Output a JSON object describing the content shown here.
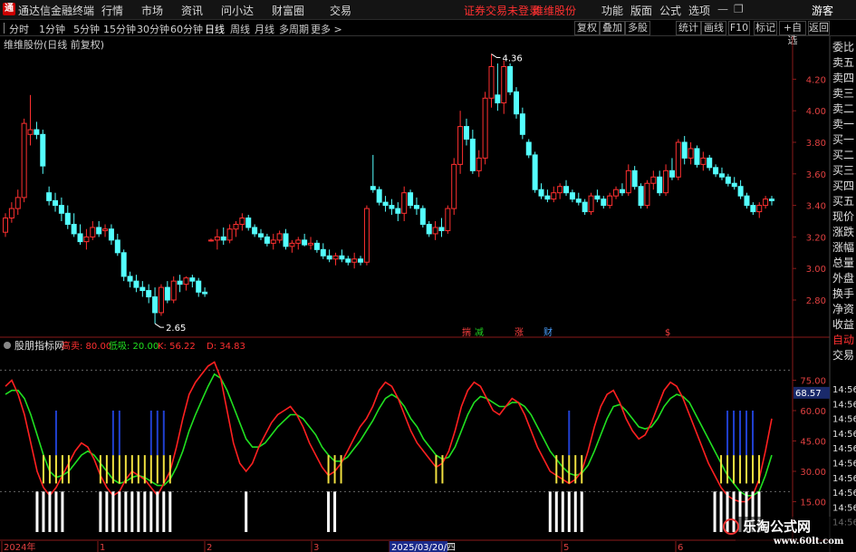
{
  "app": {
    "title": "通达信金融终端",
    "login_status": "证券交易未登录",
    "stock_name": "维维股份"
  },
  "menu": {
    "left": [
      "行情",
      "市场",
      "资讯",
      "问小达",
      "财富圈",
      "交易"
    ],
    "right": [
      "功能",
      "版面",
      "公式",
      "选项"
    ],
    "guest": "游客"
  },
  "toolbar": {
    "periods": [
      "分时",
      "1分钟",
      "5分钟",
      "15分钟",
      "30分钟",
      "60分钟",
      "日线",
      "周线",
      "月线",
      "多周期",
      "更多 >"
    ],
    "active_period": "日线",
    "buttons": [
      "复权",
      "叠加",
      "多股",
      "统计",
      "画线",
      "F10",
      "标记",
      "+自选",
      "返回"
    ]
  },
  "main_panel": {
    "title": "维维股份(日线 前复权)",
    "y_ticks": [
      "4.20",
      "4.00",
      "3.80",
      "3.60",
      "3.40",
      "3.20",
      "3.00",
      "2.80"
    ],
    "high_label": "4.36",
    "low_label": "2.65",
    "events": [
      {
        "text": "揣",
        "color": "#ff4040"
      },
      {
        "text": "减",
        "color": "#20d020"
      },
      {
        "text": "涨",
        "color": "#ff4040"
      },
      {
        "text": "财",
        "color": "#4aa0ff"
      },
      {
        "text": "$",
        "color": "#ff4040"
      }
    ]
  },
  "indicator": {
    "name": "股朋指标网",
    "params": [
      {
        "label": "高卖:",
        "value": "80.00",
        "color": "#ff3030"
      },
      {
        "label": "低吸:",
        "value": "20.00",
        "color": "#20e020"
      },
      {
        "label": "K:",
        "value": "56.22",
        "color": "#ff3030"
      },
      {
        "label": "D:",
        "value": "34.83",
        "color": "#ff3030"
      }
    ],
    "y_ticks": [
      "75.00",
      "60.00",
      "45.00",
      "30.00",
      "15.00"
    ],
    "current_value": "68.57"
  },
  "x_axis": {
    "labels": [
      "2024年",
      "1",
      "2",
      "3",
      "2025/03/20/四",
      "5",
      "6"
    ]
  },
  "right_panel": {
    "items": [
      "委比",
      "卖五",
      "卖四",
      "卖三",
      "卖二",
      "卖一",
      "买一",
      "买二",
      "买三",
      "买四",
      "买五",
      "现价",
      "涨跌",
      "涨幅",
      "总量",
      "外盘",
      "换手",
      "净资",
      "收益",
      "自动",
      "交易"
    ],
    "times": [
      "14:56",
      "14:56",
      "14:56",
      "14:56",
      "14:56",
      "14:56",
      "14:56",
      "14:56",
      "14:56",
      "14:56"
    ]
  },
  "colors": {
    "up": "#ff3030",
    "down": "#54ffff",
    "k_line": "#ff2020",
    "d_line": "#20e020",
    "accent": "#ff3030"
  },
  "watermark": {
    "site_name": "乐淘公式网",
    "url": "www.60lt.com"
  },
  "chart_data": {
    "type": "candlestick",
    "title": "维维股份(日线 前复权)",
    "ylim": [
      2.6,
      4.45
    ],
    "ohlc": [
      [
        3.23,
        3.35,
        3.2,
        3.32
      ],
      [
        3.32,
        3.42,
        3.29,
        3.38
      ],
      [
        3.38,
        3.5,
        3.34,
        3.45
      ],
      [
        3.45,
        3.95,
        3.42,
        3.92
      ],
      [
        3.85,
        4.1,
        3.78,
        3.88
      ],
      [
        3.88,
        3.93,
        3.82,
        3.85
      ],
      [
        3.85,
        3.88,
        3.6,
        3.65
      ],
      [
        3.48,
        3.52,
        3.4,
        3.43
      ],
      [
        3.43,
        3.48,
        3.36,
        3.4
      ],
      [
        3.4,
        3.45,
        3.3,
        3.35
      ],
      [
        3.35,
        3.4,
        3.25,
        3.28
      ],
      [
        3.28,
        3.35,
        3.2,
        3.22
      ],
      [
        3.22,
        3.28,
        3.15,
        3.17
      ],
      [
        3.17,
        3.25,
        3.12,
        3.2
      ],
      [
        3.2,
        3.3,
        3.18,
        3.26
      ],
      [
        3.26,
        3.3,
        3.2,
        3.22
      ],
      [
        3.24,
        3.28,
        3.2,
        3.25
      ],
      [
        3.25,
        3.28,
        3.15,
        3.18
      ],
      [
        3.18,
        3.22,
        3.08,
        3.1
      ],
      [
        3.1,
        3.12,
        2.92,
        2.95
      ],
      [
        2.95,
        2.98,
        2.88,
        2.92
      ],
      [
        2.92,
        2.96,
        2.85,
        2.88
      ],
      [
        2.88,
        2.92,
        2.82,
        2.86
      ],
      [
        2.86,
        2.9,
        2.78,
        2.82
      ],
      [
        2.82,
        2.88,
        2.65,
        2.72
      ],
      [
        2.72,
        2.9,
        2.7,
        2.88
      ],
      [
        2.88,
        2.92,
        2.78,
        2.8
      ],
      [
        2.8,
        2.95,
        2.78,
        2.92
      ],
      [
        2.92,
        2.96,
        2.85,
        2.9
      ],
      [
        2.9,
        2.95,
        2.86,
        2.94
      ],
      [
        2.94,
        2.96,
        2.88,
        2.92
      ],
      [
        2.92,
        2.94,
        2.82,
        2.85
      ],
      [
        2.85,
        2.88,
        2.82,
        2.84
      ],
      [
        3.18,
        3.19,
        3.17,
        3.18
      ],
      [
        3.18,
        3.25,
        3.12,
        3.2
      ],
      [
        3.2,
        3.26,
        3.15,
        3.18
      ],
      [
        3.18,
        3.28,
        3.16,
        3.25
      ],
      [
        3.25,
        3.3,
        3.2,
        3.28
      ],
      [
        3.28,
        3.35,
        3.24,
        3.32
      ],
      [
        3.32,
        3.34,
        3.24,
        3.26
      ],
      [
        3.26,
        3.28,
        3.2,
        3.22
      ],
      [
        3.22,
        3.25,
        3.18,
        3.2
      ],
      [
        3.2,
        3.22,
        3.14,
        3.16
      ],
      [
        3.16,
        3.22,
        3.12,
        3.18
      ],
      [
        3.18,
        3.24,
        3.16,
        3.22
      ],
      [
        3.22,
        3.25,
        3.12,
        3.14
      ],
      [
        3.14,
        3.18,
        3.1,
        3.16
      ],
      [
        3.16,
        3.2,
        3.12,
        3.18
      ],
      [
        3.18,
        3.22,
        3.14,
        3.15
      ],
      [
        3.15,
        3.2,
        3.12,
        3.16
      ],
      [
        3.16,
        3.18,
        3.1,
        3.12
      ],
      [
        3.12,
        3.16,
        3.06,
        3.08
      ],
      [
        3.08,
        3.12,
        3.04,
        3.06
      ],
      [
        3.06,
        3.1,
        3.02,
        3.08
      ],
      [
        3.08,
        3.12,
        3.04,
        3.06
      ],
      [
        3.06,
        3.08,
        3.02,
        3.04
      ],
      [
        3.04,
        3.1,
        3.0,
        3.06
      ],
      [
        3.06,
        3.08,
        3.02,
        3.04
      ],
      [
        3.04,
        3.4,
        3.02,
        3.38
      ],
      [
        3.52,
        3.72,
        3.48,
        3.5
      ],
      [
        3.5,
        3.52,
        3.4,
        3.42
      ],
      [
        3.42,
        3.46,
        3.36,
        3.4
      ],
      [
        3.4,
        3.44,
        3.34,
        3.38
      ],
      [
        3.38,
        3.42,
        3.3,
        3.35
      ],
      [
        3.35,
        3.52,
        3.3,
        3.48
      ],
      [
        3.48,
        3.5,
        3.38,
        3.4
      ],
      [
        3.4,
        3.45,
        3.34,
        3.38
      ],
      [
        3.38,
        3.4,
        3.26,
        3.28
      ],
      [
        3.28,
        3.3,
        3.2,
        3.22
      ],
      [
        3.22,
        3.3,
        3.18,
        3.26
      ],
      [
        3.26,
        3.32,
        3.2,
        3.24
      ],
      [
        3.24,
        3.4,
        3.22,
        3.38
      ],
      [
        3.38,
        3.7,
        3.34,
        3.66
      ],
      [
        3.66,
        4.0,
        3.6,
        3.9
      ],
      [
        3.9,
        3.95,
        3.78,
        3.82
      ],
      [
        3.82,
        3.88,
        3.6,
        3.62
      ],
      [
        3.62,
        3.75,
        3.58,
        3.7
      ],
      [
        3.7,
        4.12,
        3.66,
        4.08
      ],
      [
        4.08,
        4.36,
        4.02,
        4.28
      ],
      [
        4.1,
        4.3,
        4.0,
        4.05
      ],
      [
        4.05,
        4.32,
        3.98,
        4.28
      ],
      [
        4.28,
        4.3,
        4.1,
        4.12
      ],
      [
        4.12,
        4.15,
        3.95,
        3.98
      ],
      [
        3.98,
        4.02,
        3.82,
        3.85
      ],
      [
        3.8,
        3.82,
        3.7,
        3.72
      ],
      [
        3.72,
        3.74,
        3.48,
        3.5
      ],
      [
        3.5,
        3.54,
        3.44,
        3.46
      ],
      [
        3.46,
        3.5,
        3.42,
        3.44
      ],
      [
        3.44,
        3.52,
        3.42,
        3.48
      ],
      [
        3.48,
        3.54,
        3.44,
        3.52
      ],
      [
        3.52,
        3.56,
        3.46,
        3.48
      ],
      [
        3.48,
        3.5,
        3.42,
        3.44
      ],
      [
        3.44,
        3.48,
        3.4,
        3.42
      ],
      [
        3.42,
        3.44,
        3.34,
        3.36
      ],
      [
        3.36,
        3.48,
        3.34,
        3.46
      ],
      [
        3.46,
        3.5,
        3.42,
        3.44
      ],
      [
        3.44,
        3.46,
        3.38,
        3.4
      ],
      [
        3.4,
        3.48,
        3.38,
        3.46
      ],
      [
        3.46,
        3.52,
        3.44,
        3.5
      ],
      [
        3.5,
        3.54,
        3.46,
        3.48
      ],
      [
        3.48,
        3.66,
        3.46,
        3.62
      ],
      [
        3.62,
        3.65,
        3.5,
        3.52
      ],
      [
        3.52,
        3.54,
        3.38,
        3.4
      ],
      [
        3.4,
        3.56,
        3.38,
        3.54
      ],
      [
        3.54,
        3.62,
        3.5,
        3.58
      ],
      [
        3.58,
        3.62,
        3.46,
        3.48
      ],
      [
        3.48,
        3.66,
        3.46,
        3.62
      ],
      [
        3.62,
        3.7,
        3.56,
        3.58
      ],
      [
        3.58,
        3.82,
        3.56,
        3.8
      ],
      [
        3.8,
        3.84,
        3.66,
        3.7
      ],
      [
        3.7,
        3.8,
        3.66,
        3.76
      ],
      [
        3.76,
        3.78,
        3.64,
        3.66
      ],
      [
        3.66,
        3.74,
        3.62,
        3.7
      ],
      [
        3.7,
        3.72,
        3.62,
        3.64
      ],
      [
        3.64,
        3.66,
        3.58,
        3.6
      ],
      [
        3.6,
        3.64,
        3.56,
        3.58
      ],
      [
        3.58,
        3.6,
        3.52,
        3.54
      ],
      [
        3.54,
        3.58,
        3.5,
        3.52
      ],
      [
        3.52,
        3.56,
        3.44,
        3.46
      ],
      [
        3.46,
        3.48,
        3.38,
        3.4
      ],
      [
        3.4,
        3.42,
        3.34,
        3.36
      ],
      [
        3.36,
        3.42,
        3.32,
        3.4
      ],
      [
        3.4,
        3.46,
        3.38,
        3.44
      ],
      [
        3.44,
        3.46,
        3.4,
        3.43
      ]
    ],
    "indicator_k": [
      72,
      75,
      68,
      58,
      44,
      30,
      22,
      18,
      22,
      28,
      34,
      40,
      44,
      42,
      36,
      28,
      22,
      18,
      20,
      26,
      30,
      28,
      26,
      22,
      18,
      24,
      30,
      42,
      56,
      68,
      74,
      78,
      82,
      84,
      76,
      60,
      44,
      34,
      30,
      34,
      42,
      48,
      54,
      58,
      60,
      62,
      58,
      52,
      44,
      38,
      32,
      28,
      30,
      34,
      40,
      46,
      52,
      56,
      62,
      70,
      74,
      72,
      66,
      58,
      50,
      44,
      40,
      36,
      32,
      34,
      40,
      50,
      62,
      70,
      74,
      72,
      66,
      60,
      58,
      62,
      66,
      64,
      58,
      50,
      42,
      36,
      30,
      28,
      26,
      24,
      26,
      30,
      40,
      52,
      62,
      68,
      70,
      64,
      56,
      50,
      46,
      48,
      54,
      62,
      70,
      74,
      72,
      66,
      58,
      50,
      42,
      34,
      28,
      22,
      18,
      16,
      15,
      15,
      18,
      26,
      40,
      56
    ],
    "indicator_d": [
      68,
      70,
      70,
      66,
      58,
      48,
      38,
      30,
      27,
      28,
      30,
      34,
      38,
      40,
      38,
      34,
      30,
      26,
      24,
      25,
      27,
      28,
      27,
      25,
      23,
      23,
      26,
      32,
      40,
      50,
      58,
      65,
      72,
      78,
      76,
      70,
      62,
      54,
      46,
      42,
      42,
      44,
      48,
      52,
      55,
      58,
      58,
      56,
      52,
      48,
      42,
      38,
      35,
      35,
      37,
      41,
      45,
      50,
      55,
      61,
      66,
      68,
      66,
      62,
      56,
      52,
      46,
      42,
      38,
      36,
      37,
      42,
      50,
      58,
      64,
      67,
      66,
      64,
      62,
      62,
      64,
      64,
      62,
      58,
      52,
      46,
      40,
      36,
      32,
      29,
      28,
      29,
      33,
      40,
      48,
      56,
      62,
      63,
      60,
      56,
      52,
      51,
      52,
      56,
      62,
      66,
      68,
      67,
      64,
      58,
      52,
      46,
      40,
      34,
      28,
      24,
      20,
      18,
      18,
      20,
      28,
      38
    ]
  }
}
